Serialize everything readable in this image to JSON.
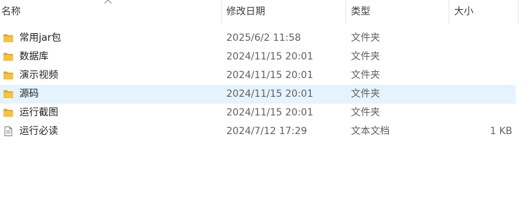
{
  "columns": {
    "name": "名称",
    "modified": "修改日期",
    "type": "类型",
    "size": "大小"
  },
  "files": [
    {
      "name": "常用jar包",
      "modified": "2025/6/2 11:58",
      "type": "文件夹",
      "size": "",
      "icon": "folder-icon",
      "selected": false
    },
    {
      "name": "数据库",
      "modified": "2024/11/15 20:01",
      "type": "文件夹",
      "size": "",
      "icon": "folder-icon",
      "selected": false
    },
    {
      "name": "演示视频",
      "modified": "2024/11/15 20:01",
      "type": "文件夹",
      "size": "",
      "icon": "folder-icon",
      "selected": false
    },
    {
      "name": "源码",
      "modified": "2024/11/15 20:01",
      "type": "文件夹",
      "size": "",
      "icon": "folder-icon",
      "selected": true
    },
    {
      "name": "运行截图",
      "modified": "2024/11/15 20:01",
      "type": "文件夹",
      "size": "",
      "icon": "folder-icon",
      "selected": false
    },
    {
      "name": "运行必读",
      "modified": "2024/7/12 17:29",
      "type": "文本文档",
      "size": "1 KB",
      "icon": "text-document-icon",
      "selected": false
    }
  ],
  "colors": {
    "selection": "#e5f3ff",
    "folder": "#f5c242",
    "folder_dark": "#dba62a"
  }
}
